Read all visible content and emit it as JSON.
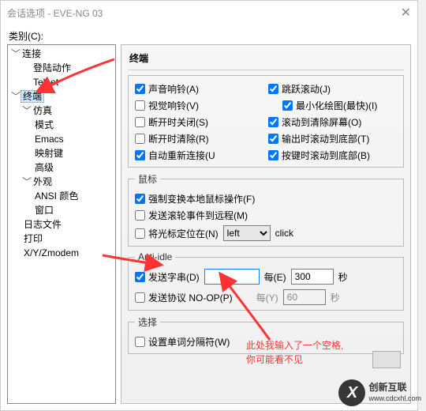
{
  "title": "会话选项 - EVE-NG 03",
  "category_label": "类别(C):",
  "tree": {
    "n0": "连接",
    "n0_0": "登陆动作",
    "n0_1": "Telnet",
    "n1": "终端",
    "n1_0": "仿真",
    "n1_0_0": "模式",
    "n1_0_1": "Emacs",
    "n1_0_2": "映射键",
    "n1_0_3": "高级",
    "n1_1": "外观",
    "n1_1_0": "ANSI 颜色",
    "n1_1_1": "窗口",
    "n1_2": "日志文件",
    "n1_3": "打印",
    "n1_4": "X/Y/Zmodem"
  },
  "panel_title": "终端",
  "group1": {
    "c1": "声音响铃(A)",
    "c2": "视觉响铃(V)",
    "c3": "断开时关闭(S)",
    "c4": "断开时清除(R)",
    "c5": "自动重新连接(U",
    "r1": "跳跃滚动(J)",
    "r1a": "最小化绘图(最快)(I)",
    "r2": "滚动到清除屏幕(O)",
    "r3": "输出时滚动到底部(T)",
    "r4": "按键时滚动到底部(B)"
  },
  "mouse": {
    "legend": "鼠标",
    "c1": "强制变换本地鼠标操作(F)",
    "c2": "发送滚轮事件到远程(M)",
    "c3": "将光标定位在(N)",
    "sel": "left",
    "after": "click"
  },
  "anti": {
    "legend": "Anti-idle",
    "c1": "发送字串(D)",
    "c1_val": "",
    "every1_lbl": "每(E)",
    "every1_val": "300",
    "sec": "秒",
    "c2": "发送协议 NO-OP(P)",
    "every2_lbl": "每(Y)",
    "every2_val": "60"
  },
  "select": {
    "legend": "选择",
    "c1": "设置单词分隔符(W)"
  },
  "annotation": {
    "line1": "此处我输入了一个空格,",
    "line2": "你可能看不见"
  },
  "watermark": {
    "logo": "X",
    "t1": "创新互联",
    "t2": "www.cdcxhl.com"
  }
}
